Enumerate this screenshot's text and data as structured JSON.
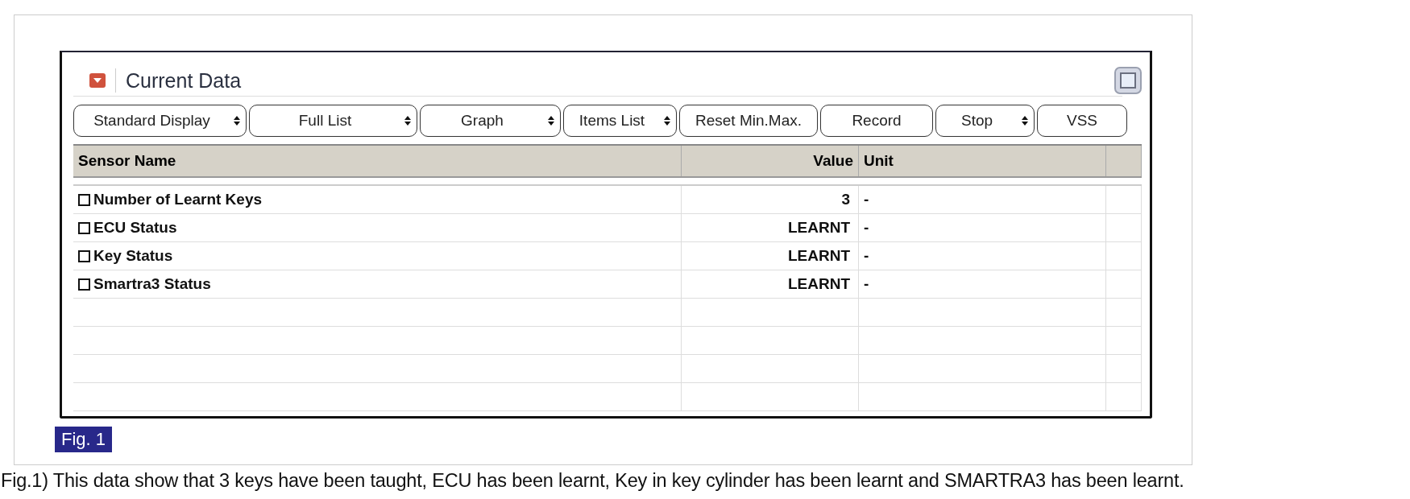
{
  "panel": {
    "title": "Current Data"
  },
  "toolbar": [
    {
      "label": "Standard Display",
      "kind": "select"
    },
    {
      "label": "Full List",
      "kind": "select"
    },
    {
      "label": "Graph",
      "kind": "select"
    },
    {
      "label": "Items List",
      "kind": "select"
    },
    {
      "label": "Reset Min.Max.",
      "kind": "button"
    },
    {
      "label": "Record",
      "kind": "button"
    },
    {
      "label": "Stop",
      "kind": "select"
    },
    {
      "label": "VSS",
      "kind": "button"
    }
  ],
  "table": {
    "columns": [
      "Sensor Name",
      "Value",
      "Unit"
    ],
    "rows": [
      {
        "name": "Number of Learnt Keys",
        "value": "3",
        "unit": "-",
        "checked": false
      },
      {
        "name": "ECU Status",
        "value": "LEARNT",
        "unit": "-",
        "checked": false
      },
      {
        "name": "Key Status",
        "value": "LEARNT",
        "unit": "-",
        "checked": false
      },
      {
        "name": "Smartra3 Status",
        "value": "LEARNT",
        "unit": "-",
        "checked": false
      }
    ]
  },
  "figure_label": "Fig. 1",
  "caption": "Fig.1) This data show that 3 keys have been taught, ECU has been learnt, Key in key cylinder has been learnt and SMARTRA3 has been learnt."
}
